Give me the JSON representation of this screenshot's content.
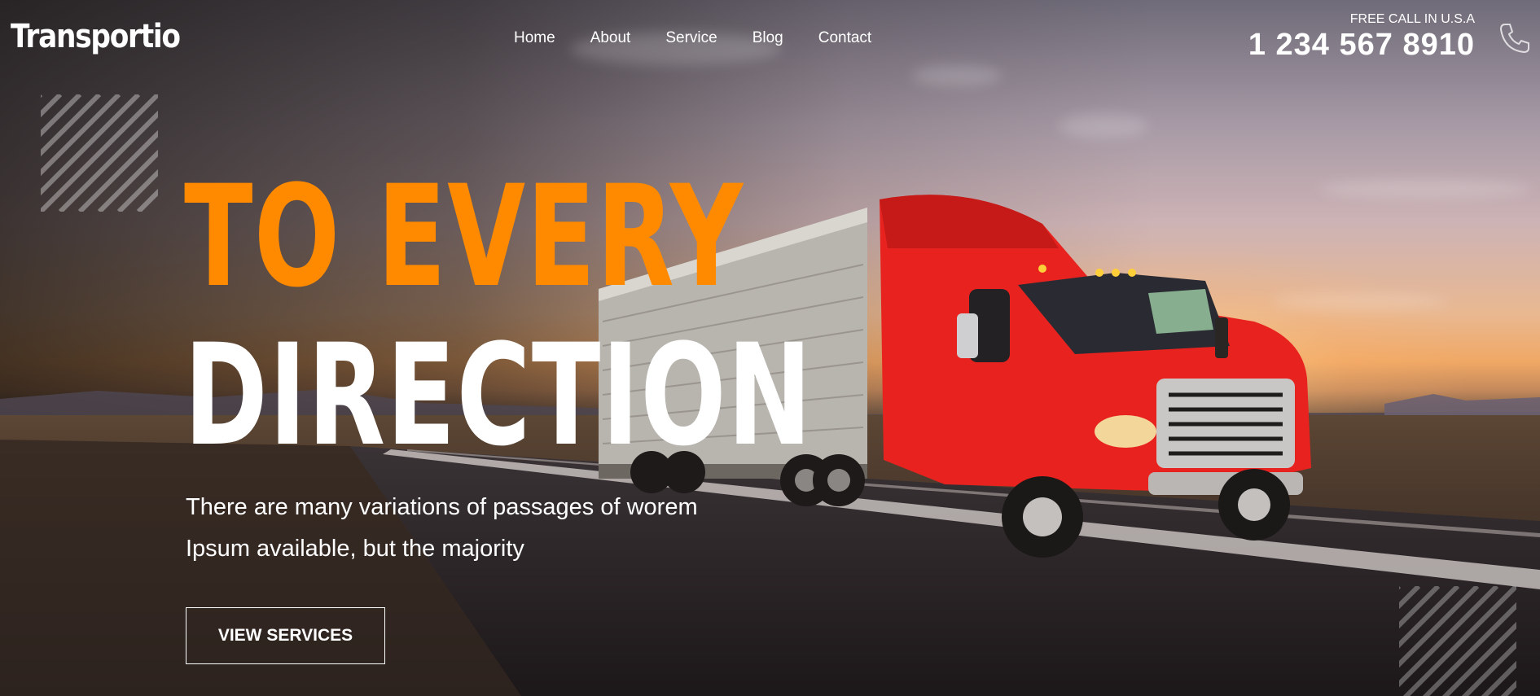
{
  "brand": {
    "name": "Transportio"
  },
  "nav": {
    "items": [
      {
        "label": "Home"
      },
      {
        "label": "About"
      },
      {
        "label": "Service"
      },
      {
        "label": "Blog"
      },
      {
        "label": "Contact"
      }
    ]
  },
  "contact": {
    "label": "FREE CALL IN U.S.A",
    "phone": "1 234 567 8910",
    "icon": "phone-icon"
  },
  "hero": {
    "headline_line1": "TO EVERY",
    "headline_line2": "DIRECTION",
    "subtext_line1": "There are many variations of passages of worem",
    "subtext_line2": "Ipsum available, but the majority",
    "cta_label": "VIEW SERVICES"
  },
  "colors": {
    "accent": "#ff8a00",
    "text": "#ffffff",
    "truck_cab": "#e8231f"
  }
}
